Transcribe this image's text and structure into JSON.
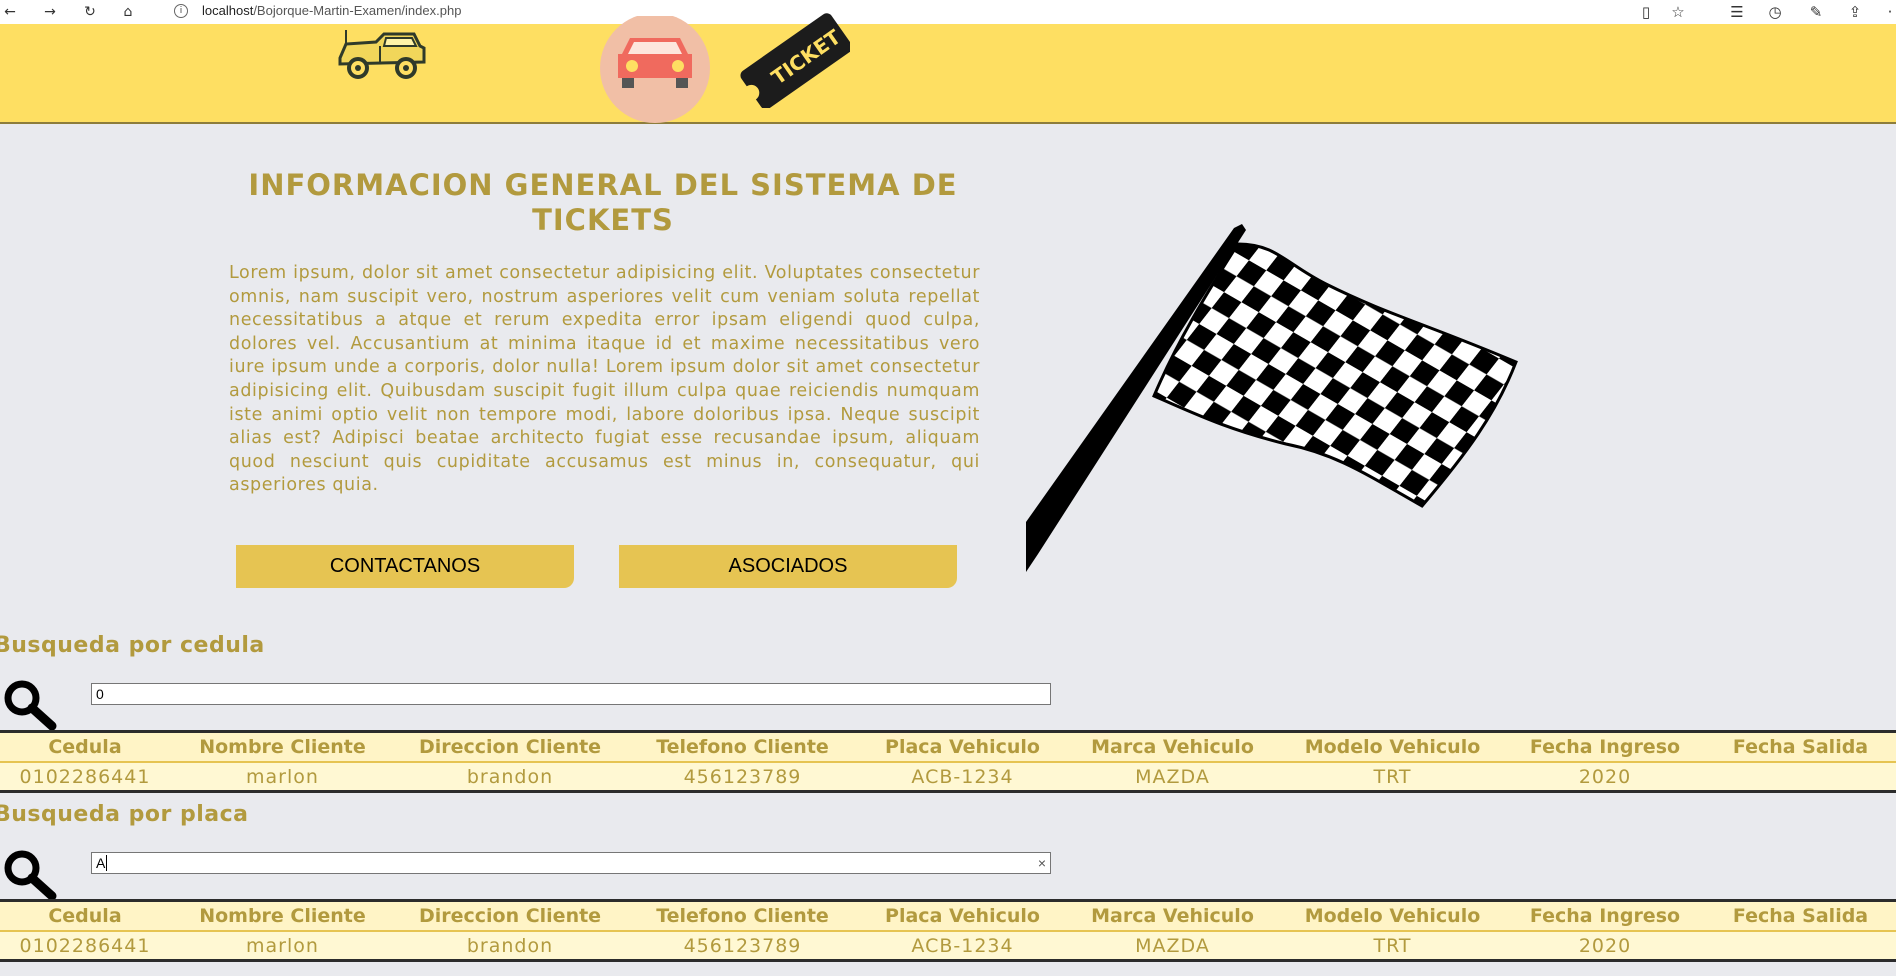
{
  "browser": {
    "url_host": "localhost",
    "url_path": "/Bojorque-Martin-Examen/index.php"
  },
  "header": {
    "ticket_label": "TICKET"
  },
  "info": {
    "title": "INFORMACION GENERAL DEL SISTEMA DE TICKETS",
    "body": "Lorem ipsum, dolor sit amet consectetur adipisicing elit. Voluptates consectetur omnis, nam suscipit vero, nostrum asperiores velit cum veniam soluta repellat necessitatibus a atque et rerum expedita error ipsam eligendi quod culpa, dolores vel. Accusantium at minima itaque id et maxime necessitatibus vero iure ipsum unde a corporis, dolor nulla! Lorem ipsum dolor sit amet consectetur adipisicing elit. Quibusdam suscipit fugit illum culpa quae reiciendis numquam iste animi optio velit non tempore modi, labore doloribus ipsa. Neque suscipit alias est? Adipisci beatae architecto fugiat esse recusandae ipsum, aliquam quod nesciunt quis cupiditate accusamus est minus in, consequatur, qui asperiores quia.",
    "buttons": {
      "contact": "CONTACTANOS",
      "associates": "ASOCIADOS"
    }
  },
  "search_cedula": {
    "title": "Busqueda por cedula",
    "value": "0"
  },
  "search_placa": {
    "title": "Busqueda por placa",
    "value": "A"
  },
  "columns": [
    "Cedula",
    "Nombre Cliente",
    "Direccion Cliente",
    "Telefono Cliente",
    "Placa Vehiculo",
    "Marca Vehiculo",
    "Modelo Vehiculo",
    "Fecha Ingreso",
    "Fecha Salida"
  ],
  "results_cedula": [
    [
      "0102286441",
      "marlon",
      "brandon",
      "456123789",
      "ACB-1234",
      "MAZDA",
      "TRT",
      "2020",
      ""
    ]
  ],
  "results_placa": [
    [
      "0102286441",
      "marlon",
      "brandon",
      "456123789",
      "ACB-1234",
      "MAZDA",
      "TRT",
      "2020",
      ""
    ]
  ],
  "colors": {
    "header_yellow": "#fedf62",
    "accent_gold": "#b29a3e",
    "button_gold": "#e6c452"
  }
}
